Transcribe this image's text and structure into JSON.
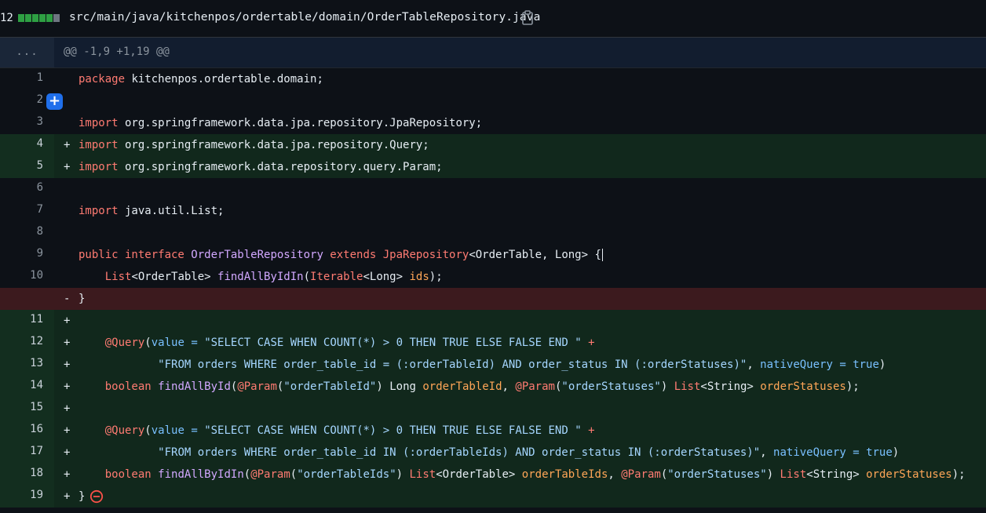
{
  "file": {
    "change_count": "12",
    "path": "src/main/java/kitchenpos/ordertable/domain/OrderTableRepository.java",
    "diffstat": [
      "add",
      "add",
      "add",
      "add",
      "add",
      "neutral"
    ]
  },
  "hunk": {
    "expander": "...",
    "header": "@@ -1,9 +1,19 @@"
  },
  "lines": [
    {
      "num": "1",
      "type": "ctx",
      "sign": "",
      "tokens": [
        [
          "kw",
          "package"
        ],
        [
          "pl",
          " kitchenpos.ordertable.domain;"
        ]
      ]
    },
    {
      "num": "2",
      "type": "ctx",
      "sign": "",
      "tokens": []
    },
    {
      "num": "3",
      "type": "ctx",
      "sign": "",
      "tokens": [
        [
          "kw",
          "import"
        ],
        [
          "pl",
          " org.springframework.data.jpa.repository.JpaRepository;"
        ]
      ]
    },
    {
      "num": "4",
      "type": "add",
      "sign": "+",
      "tokens": [
        [
          "kw",
          "import"
        ],
        [
          "pl",
          " org.springframework.data.jpa.repository.Query;"
        ]
      ]
    },
    {
      "num": "5",
      "type": "add",
      "sign": "+",
      "tokens": [
        [
          "kw",
          "import"
        ],
        [
          "pl",
          " org.springframework.data.repository.query.Param;"
        ]
      ]
    },
    {
      "num": "6",
      "type": "ctx",
      "sign": "",
      "tokens": []
    },
    {
      "num": "7",
      "type": "ctx",
      "sign": "",
      "tokens": [
        [
          "kw",
          "import"
        ],
        [
          "pl",
          " java.util.List;"
        ]
      ]
    },
    {
      "num": "8",
      "type": "ctx",
      "sign": "",
      "tokens": []
    },
    {
      "num": "9",
      "type": "ctx",
      "sign": "",
      "tokens": [
        [
          "kw",
          "public interface "
        ],
        [
          "ty",
          "OrderTableRepository"
        ],
        [
          "kw",
          " extends "
        ],
        [
          "kw",
          "JpaRepository"
        ],
        [
          "pl",
          "<OrderTable, Long> {"
        ]
      ]
    },
    {
      "num": "10",
      "type": "ctx",
      "sign": "",
      "tokens": [
        [
          "pl",
          "    "
        ],
        [
          "kw",
          "List"
        ],
        [
          "pl",
          "<OrderTable> "
        ],
        [
          "fn",
          "findAllByIdIn"
        ],
        [
          "pl",
          "("
        ],
        [
          "kw",
          "Iterable"
        ],
        [
          "pl",
          "<Long> "
        ],
        [
          "pa",
          "ids"
        ],
        [
          "pl",
          ");"
        ]
      ]
    },
    {
      "num": "",
      "type": "del",
      "sign": "-",
      "tokens": [
        [
          "pl",
          "}"
        ]
      ]
    },
    {
      "num": "11",
      "type": "add",
      "sign": "+",
      "tokens": []
    },
    {
      "num": "12",
      "type": "add",
      "sign": "+",
      "tokens": [
        [
          "pl",
          "    "
        ],
        [
          "an",
          "@Query"
        ],
        [
          "pl",
          "("
        ],
        [
          "va",
          "value"
        ],
        [
          "pl",
          " "
        ],
        [
          "va",
          "="
        ],
        [
          "pl",
          " "
        ],
        [
          "st",
          "\"SELECT CASE WHEN COUNT(*) > 0 THEN TRUE ELSE FALSE END \""
        ],
        [
          "pl",
          " "
        ],
        [
          "kw",
          "+"
        ]
      ]
    },
    {
      "num": "13",
      "type": "add",
      "sign": "+",
      "tokens": [
        [
          "pl",
          "            "
        ],
        [
          "st",
          "\"FROM orders WHERE order_table_id = (:orderTableId) AND order_status IN (:orderStatuses)\""
        ],
        [
          "pl",
          ", "
        ],
        [
          "va",
          "nativeQuery"
        ],
        [
          "pl",
          " "
        ],
        [
          "va",
          "="
        ],
        [
          "pl",
          " "
        ],
        [
          "va",
          "true"
        ],
        [
          "pl",
          ")"
        ]
      ]
    },
    {
      "num": "14",
      "type": "add",
      "sign": "+",
      "tokens": [
        [
          "pl",
          "    "
        ],
        [
          "kw",
          "boolean"
        ],
        [
          "pl",
          " "
        ],
        [
          "fn",
          "findAllById"
        ],
        [
          "pl",
          "("
        ],
        [
          "an",
          "@Param"
        ],
        [
          "pl",
          "("
        ],
        [
          "st",
          "\"orderTableId\""
        ],
        [
          "pl",
          ") Long "
        ],
        [
          "pa",
          "orderTableId"
        ],
        [
          "pl",
          ", "
        ],
        [
          "an",
          "@Param"
        ],
        [
          "pl",
          "("
        ],
        [
          "st",
          "\"orderStatuses\""
        ],
        [
          "pl",
          ") "
        ],
        [
          "kw",
          "List"
        ],
        [
          "pl",
          "<String> "
        ],
        [
          "pa",
          "orderStatuses"
        ],
        [
          "pl",
          ");"
        ]
      ]
    },
    {
      "num": "15",
      "type": "add",
      "sign": "+",
      "tokens": []
    },
    {
      "num": "16",
      "type": "add",
      "sign": "+",
      "tokens": [
        [
          "pl",
          "    "
        ],
        [
          "an",
          "@Query"
        ],
        [
          "pl",
          "("
        ],
        [
          "va",
          "value"
        ],
        [
          "pl",
          " "
        ],
        [
          "va",
          "="
        ],
        [
          "pl",
          " "
        ],
        [
          "st",
          "\"SELECT CASE WHEN COUNT(*) > 0 THEN TRUE ELSE FALSE END \""
        ],
        [
          "pl",
          " "
        ],
        [
          "kw",
          "+"
        ]
      ]
    },
    {
      "num": "17",
      "type": "add",
      "sign": "+",
      "tokens": [
        [
          "pl",
          "            "
        ],
        [
          "st",
          "\"FROM orders WHERE order_table_id IN (:orderTableIds) AND order_status IN (:orderStatuses)\""
        ],
        [
          "pl",
          ", "
        ],
        [
          "va",
          "nativeQuery"
        ],
        [
          "pl",
          " "
        ],
        [
          "va",
          "="
        ],
        [
          "pl",
          " "
        ],
        [
          "va",
          "true"
        ],
        [
          "pl",
          ")"
        ]
      ]
    },
    {
      "num": "18",
      "type": "add",
      "sign": "+",
      "tokens": [
        [
          "pl",
          "    "
        ],
        [
          "kw",
          "boolean"
        ],
        [
          "pl",
          " "
        ],
        [
          "fn",
          "findAllByIdIn"
        ],
        [
          "pl",
          "("
        ],
        [
          "an",
          "@Param"
        ],
        [
          "pl",
          "("
        ],
        [
          "st",
          "\"orderTableIds\""
        ],
        [
          "pl",
          ") "
        ],
        [
          "kw",
          "List"
        ],
        [
          "pl",
          "<OrderTable> "
        ],
        [
          "pa",
          "orderTableIds"
        ],
        [
          "pl",
          ", "
        ],
        [
          "an",
          "@Param"
        ],
        [
          "pl",
          "("
        ],
        [
          "st",
          "\"orderStatuses\""
        ],
        [
          "pl",
          ") "
        ],
        [
          "kw",
          "List"
        ],
        [
          "pl",
          "<String> "
        ],
        [
          "pa",
          "orderStatuses"
        ],
        [
          "pl",
          ");"
        ]
      ]
    },
    {
      "num": "19",
      "type": "add",
      "sign": "+",
      "tokens": [
        [
          "pl",
          "}"
        ]
      ]
    }
  ],
  "colors": {
    "background": "#0d1117",
    "added_line": "#11281c",
    "deleted_line": "#3c1a1e",
    "accent": "#1f6feb"
  },
  "icons": {
    "copy": "clipboard-icon",
    "add_comment": "plus-icon",
    "remove": "remove-circle-icon"
  }
}
